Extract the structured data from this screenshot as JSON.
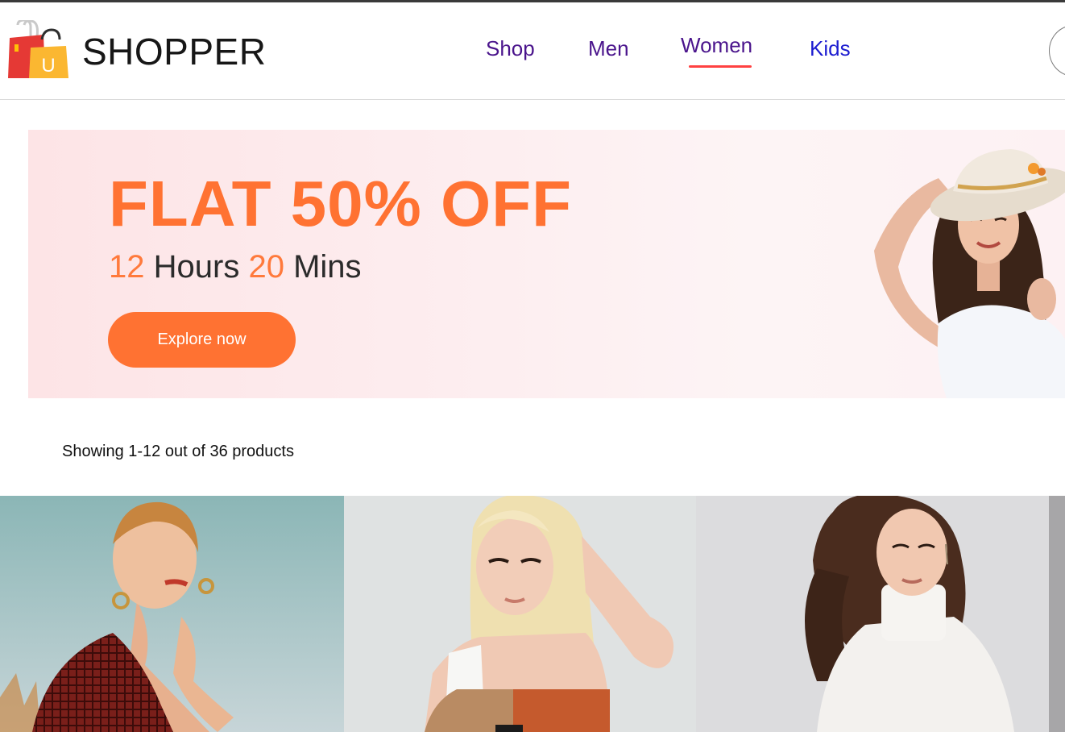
{
  "brand": {
    "name": "SHOPPER",
    "logo_icon": "shopping-bags-icon",
    "logo_letter": "U"
  },
  "nav": {
    "items": [
      {
        "label": "Shop",
        "active": false
      },
      {
        "label": "Men",
        "active": false
      },
      {
        "label": "Women",
        "active": true
      },
      {
        "label": "Kids",
        "active": false
      }
    ],
    "accent_color": "#ff4141"
  },
  "hero": {
    "headline": "FLAT 50% OFF",
    "timer": {
      "hours": "12",
      "hours_label": "Hours",
      "mins": "20",
      "mins_label": "Mins"
    },
    "cta_label": "Explore now",
    "accent_color": "#ff7232"
  },
  "results": {
    "text": "Showing 1-12 out of 36 products"
  },
  "products": [
    {
      "image_icon": "woman-red-patterned-top-photo"
    },
    {
      "image_icon": "woman-blonde-tank-top-photo"
    },
    {
      "image_icon": "woman-white-turtleneck-photo"
    }
  ]
}
